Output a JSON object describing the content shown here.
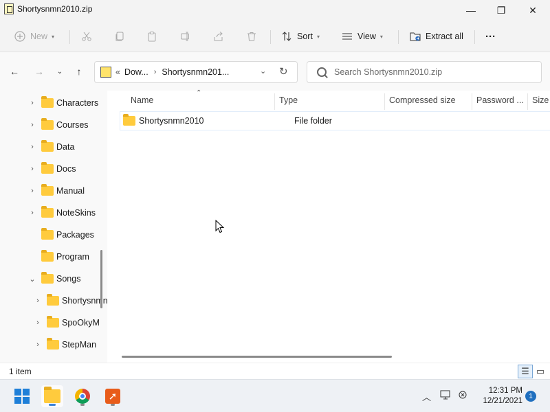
{
  "window": {
    "title": "Shortysnmn2010.zip",
    "minimize": "—",
    "maximize": "❐",
    "close": "✕"
  },
  "commandbar": {
    "new_label": "New",
    "sort_label": "Sort",
    "view_label": "View",
    "extract_label": "Extract all",
    "more_label": "···"
  },
  "address": {
    "crumb_overflow": "«",
    "crumb_1": "Dow...",
    "crumb_2": "Shortysnmn201..."
  },
  "search": {
    "placeholder": "Search Shortysnmn2010.zip"
  },
  "navpane": {
    "items": [
      {
        "label": "Characters",
        "expander": "›"
      },
      {
        "label": "Courses",
        "expander": "›"
      },
      {
        "label": "Data",
        "expander": "›"
      },
      {
        "label": "Docs",
        "expander": "›"
      },
      {
        "label": "Manual",
        "expander": "›"
      },
      {
        "label": "NoteSkins",
        "expander": "›"
      },
      {
        "label": "Packages",
        "expander": ""
      },
      {
        "label": "Program",
        "expander": ""
      },
      {
        "label": "Songs",
        "expander": "⌄"
      },
      {
        "label": "Shortysnmn",
        "expander": "›"
      },
      {
        "label": "SpoOkyM",
        "expander": "›"
      },
      {
        "label": "StepMan",
        "expander": "›"
      }
    ]
  },
  "columns": {
    "name": "Name",
    "type": "Type",
    "compressed_size": "Compressed size",
    "password": "Password ...",
    "size": "Size"
  },
  "files": [
    {
      "name": "Shortysnmn2010",
      "type": "File folder"
    }
  ],
  "status": {
    "item_count": "1 item"
  },
  "taskbar": {
    "time": "12:31 PM",
    "date": "12/21/2021",
    "notifications": "1"
  },
  "colors": {
    "folder": "#ffcb3d",
    "accent": "#1e7fd8"
  }
}
